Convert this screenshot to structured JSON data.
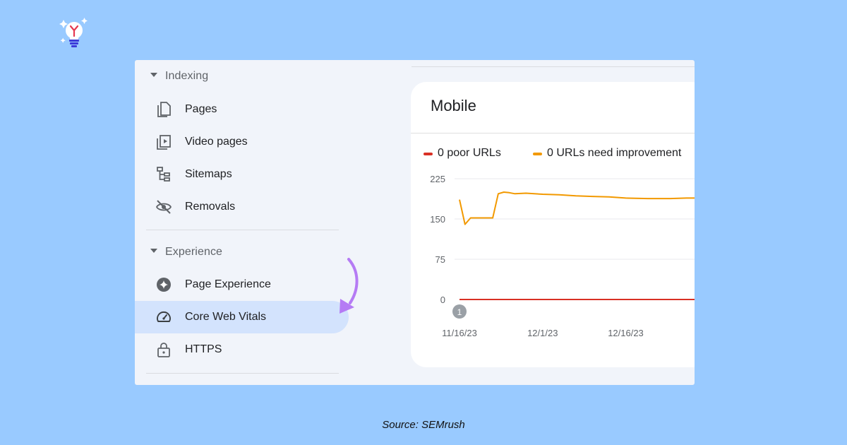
{
  "sidebar": {
    "sections": [
      {
        "title": "Indexing",
        "items": [
          {
            "label": "Pages",
            "icon": "pages-icon"
          },
          {
            "label": "Video pages",
            "icon": "video-pages-icon"
          },
          {
            "label": "Sitemaps",
            "icon": "sitemap-icon"
          },
          {
            "label": "Removals",
            "icon": "eye-off-icon"
          }
        ]
      },
      {
        "title": "Experience",
        "items": [
          {
            "label": "Page Experience",
            "icon": "page-experience-icon"
          },
          {
            "label": "Core Web Vitals",
            "icon": "speedometer-icon",
            "active": true
          },
          {
            "label": "HTTPS",
            "icon": "lock-icon"
          }
        ]
      }
    ]
  },
  "card": {
    "title": "Mobile",
    "legend": [
      {
        "label": "0 poor URLs",
        "color": "#d93025"
      },
      {
        "label": "0 URLs need improvement",
        "color": "#f29900"
      }
    ]
  },
  "chart_data": {
    "type": "line",
    "y_ticks": [
      "225",
      "150",
      "75",
      "0"
    ],
    "ylim": [
      0,
      225
    ],
    "x_ticks": [
      "11/16/23",
      "12/1/23",
      "12/16/23"
    ],
    "annotation": "1",
    "series": [
      {
        "name": "0 poor URLs",
        "color": "#d93025",
        "x": [
          "11/16/23",
          "12/31/23"
        ],
        "values": [
          0,
          0
        ]
      },
      {
        "name": "0 URLs need improvement",
        "color": "#f29900",
        "x": [
          "11/16/23",
          "11/17/23",
          "11/18/23",
          "11/19/23",
          "11/22/23",
          "11/23/23",
          "11/24/23",
          "11/25/23",
          "11/26/23",
          "11/28/23",
          "12/1/23",
          "12/4/23",
          "12/7/23",
          "12/10/23",
          "12/13/23",
          "12/16/23",
          "12/20/23",
          "12/24/23",
          "12/27/23",
          "12/31/23"
        ],
        "values": [
          186,
          140,
          152,
          152,
          152,
          197,
          200,
          199,
          197,
          198,
          196,
          195,
          193,
          192,
          191,
          189,
          188,
          188,
          189,
          189
        ]
      }
    ]
  },
  "caption": "Source: SEMrush"
}
